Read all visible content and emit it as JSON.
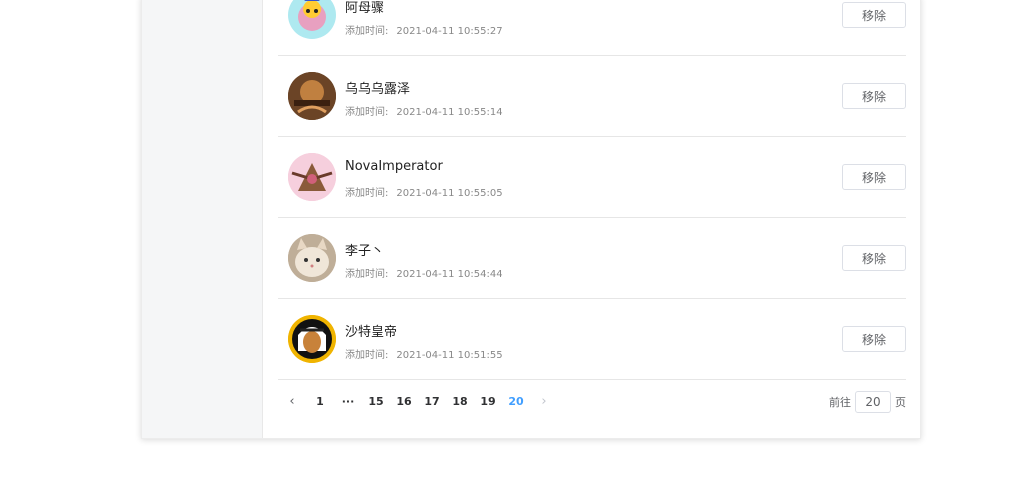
{
  "list": {
    "time_label": "添加时间:",
    "remove_label": "移除",
    "items": [
      {
        "name": "阿母骤",
        "time": "2021-04-11 10:55:27",
        "avatar": "cartoon-bird-avatar"
      },
      {
        "name": "乌乌乌露泽",
        "time": "2021-04-11 10:55:14",
        "avatar": "game-poster-avatar"
      },
      {
        "name": "NovaImperator",
        "time": "2021-04-11 10:55:05",
        "avatar": "pink-creature-avatar"
      },
      {
        "name": "李子丶",
        "time": "2021-04-11 10:54:44",
        "avatar": "cat-face-avatar"
      },
      {
        "name": "沙特皇帝",
        "time": "2021-04-11 10:51:55",
        "avatar": "sheikh-cartoon-avatar"
      }
    ]
  },
  "pagination": {
    "pages": [
      "1",
      "···",
      "15",
      "16",
      "17",
      "18",
      "19",
      "20"
    ],
    "current": "20",
    "goto_prefix": "前往",
    "goto_value": "20",
    "goto_suffix": "页"
  },
  "colors": {
    "active_page": "#409eff",
    "avatar_bg_1": "#aee9f0",
    "avatar_bg_5": "#f0b400"
  }
}
